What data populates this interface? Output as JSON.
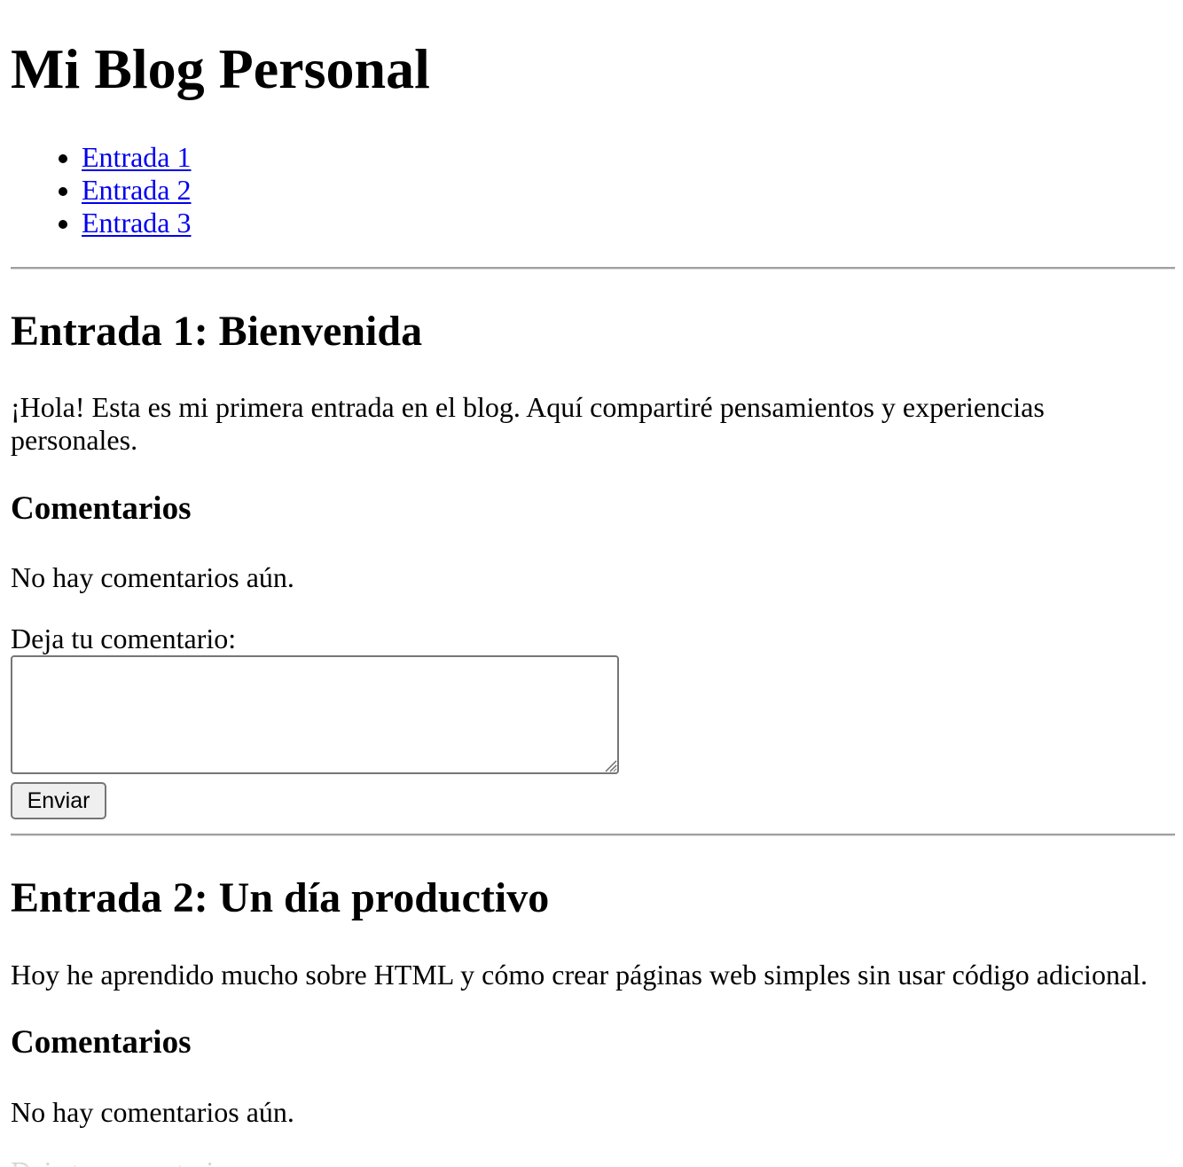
{
  "site": {
    "title": "Mi Blog Personal"
  },
  "nav": {
    "items": [
      {
        "label": "Entrada 1"
      },
      {
        "label": "Entrada 2"
      },
      {
        "label": "Entrada 3"
      }
    ]
  },
  "entries": [
    {
      "title": "Entrada 1: Bienvenida",
      "text": "¡Hola! Esta es mi primera entrada en el blog. Aquí compartiré pensamientos y experiencias personales.",
      "comments_title": "Comentarios",
      "no_comments": "No hay comentarios aún.",
      "comment_label": "Deja tu comentario:",
      "comment_value": "",
      "submit_label": "Enviar"
    },
    {
      "title": "Entrada 2: Un día productivo",
      "text": "Hoy he aprendido mucho sobre HTML y cómo crear páginas web simples sin usar código adicional.",
      "comments_title": "Comentarios",
      "no_comments": "No hay comentarios aún.",
      "comment_label": "Deja tu comentario:"
    }
  ],
  "colors": {
    "link": "#0000ee",
    "divider": "#a0a0a0",
    "button_background": "#efefef",
    "control_border": "#767676"
  }
}
